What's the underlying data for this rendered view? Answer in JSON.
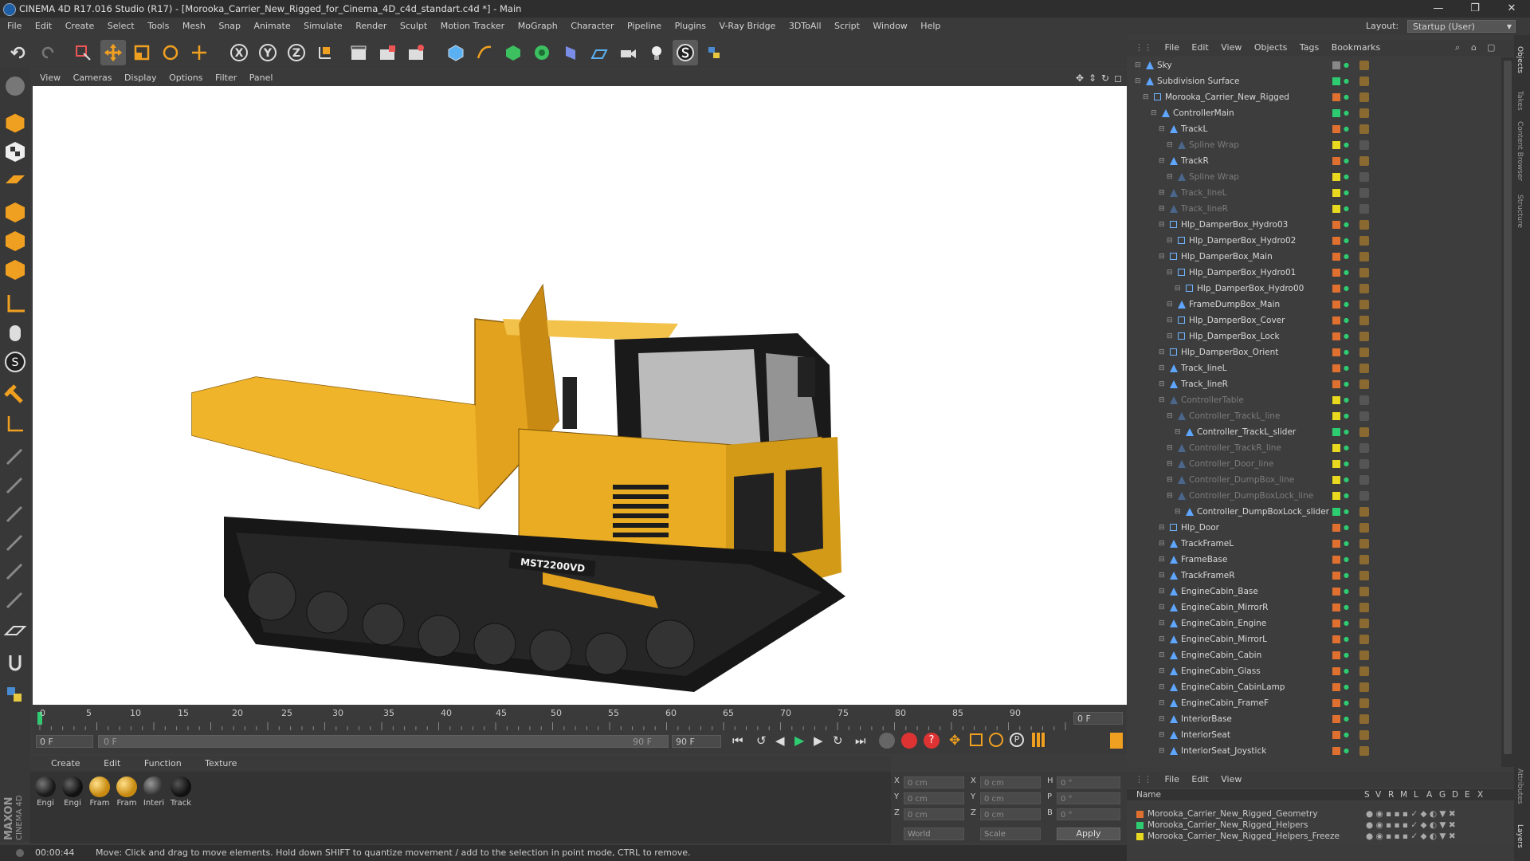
{
  "window": {
    "title": "CINEMA 4D R17.016 Studio (R17) - [Morooka_Carrier_New_Rigged_for_Cinema_4D_c4d_standart.c4d *] - Main",
    "controls": [
      "—",
      "❐",
      "✕"
    ]
  },
  "menu": {
    "items": [
      "File",
      "Edit",
      "Create",
      "Select",
      "Tools",
      "Mesh",
      "Snap",
      "Animate",
      "Simulate",
      "Render",
      "Sculpt",
      "Motion Tracker",
      "MoGraph",
      "Character",
      "Pipeline",
      "Plugins",
      "V-Ray Bridge",
      "3DToAll",
      "Script",
      "Window",
      "Help"
    ],
    "layout_label": "Layout:",
    "layout_value": "Startup (User)"
  },
  "toolbar": {
    "axis_x": "X",
    "axis_y": "Y",
    "axis_z": "Z"
  },
  "viewport": {
    "menu": [
      "View",
      "Cameras",
      "Display",
      "Options",
      "Filter",
      "Panel"
    ],
    "model_label": "MST2200VD"
  },
  "timeline": {
    "ticks": [
      "0",
      "5",
      "10",
      "15",
      "20",
      "25",
      "30",
      "35",
      "40",
      "45",
      "50",
      "55",
      "60",
      "65",
      "70",
      "75",
      "80",
      "85",
      "90"
    ],
    "current_frame_box": "0 F",
    "start_field": "0 F",
    "slider_start": "0 F",
    "slider_end": "90 F",
    "end_field": "90 F"
  },
  "materials": {
    "menu": [
      "Create",
      "Edit",
      "Function",
      "Texture"
    ],
    "items": [
      {
        "label": "Engi",
        "color": "#2a2a2a"
      },
      {
        "label": "Engi",
        "color": "#1c1c1c"
      },
      {
        "label": "Fram",
        "color": "#d9a521"
      },
      {
        "label": "Fram",
        "color": "#d9a521"
      },
      {
        "label": "Interi",
        "color": "#444"
      },
      {
        "label": "Track",
        "color": "#222"
      }
    ]
  },
  "coords": {
    "rows": [
      {
        "a": "X",
        "av": "0 cm",
        "b": "X",
        "bv": "0 cm",
        "c": "H",
        "cv": "0 °"
      },
      {
        "a": "Y",
        "av": "0 cm",
        "b": "Y",
        "bv": "0 cm",
        "c": "P",
        "cv": "0 °"
      },
      {
        "a": "Z",
        "av": "0 cm",
        "b": "Z",
        "bv": "0 cm",
        "c": "B",
        "cv": "0 °"
      }
    ],
    "world": "World",
    "scale": "Scale",
    "apply": "Apply"
  },
  "status": {
    "time": "00:00:44",
    "message": "Move: Click and drag to move elements. Hold down SHIFT to quantize movement / add to the selection in point mode, CTRL to remove."
  },
  "objects": {
    "menu": [
      "File",
      "Edit",
      "View",
      "Objects",
      "Tags",
      "Bookmarks"
    ],
    "rows": [
      {
        "name": "Sky",
        "indent": 0,
        "color": "#888",
        "dim": false
      },
      {
        "name": "Subdivision Surface",
        "indent": 0,
        "color": "#2ecc71",
        "dim": false
      },
      {
        "name": "Morooka_Carrier_New_Rigged",
        "indent": 1,
        "color": "#e07030",
        "dim": false
      },
      {
        "name": "ControllerMain",
        "indent": 2,
        "color": "#2ecc71",
        "dim": false
      },
      {
        "name": "TrackL",
        "indent": 3,
        "color": "#e07030",
        "dim": false
      },
      {
        "name": "Spline Wrap",
        "indent": 4,
        "color": "#e8d820",
        "dim": true
      },
      {
        "name": "TrackR",
        "indent": 3,
        "color": "#e07030",
        "dim": false
      },
      {
        "name": "Spline Wrap",
        "indent": 4,
        "color": "#e8d820",
        "dim": true
      },
      {
        "name": "Track_lineL",
        "indent": 3,
        "color": "#e8d820",
        "dim": true
      },
      {
        "name": "Track_lineR",
        "indent": 3,
        "color": "#e8d820",
        "dim": true
      },
      {
        "name": "Hlp_DamperBox_Hydro03",
        "indent": 3,
        "color": "#e07030",
        "dim": false
      },
      {
        "name": "Hlp_DamperBox_Hydro02",
        "indent": 4,
        "color": "#e07030",
        "dim": false
      },
      {
        "name": "Hlp_DamperBox_Main",
        "indent": 3,
        "color": "#e07030",
        "dim": false
      },
      {
        "name": "Hlp_DamperBox_Hydro01",
        "indent": 4,
        "color": "#e07030",
        "dim": false
      },
      {
        "name": "Hlp_DamperBox_Hydro00",
        "indent": 5,
        "color": "#e07030",
        "dim": false
      },
      {
        "name": "FrameDumpBox_Main",
        "indent": 4,
        "color": "#e07030",
        "dim": false
      },
      {
        "name": "Hlp_DamperBox_Cover",
        "indent": 4,
        "color": "#e07030",
        "dim": false
      },
      {
        "name": "Hlp_DamperBox_Lock",
        "indent": 4,
        "color": "#e07030",
        "dim": false
      },
      {
        "name": "Hlp_DamperBox_Orient",
        "indent": 3,
        "color": "#e07030",
        "dim": false
      },
      {
        "name": "Track_lineL",
        "indent": 3,
        "color": "#e07030",
        "dim": false
      },
      {
        "name": "Track_lineR",
        "indent": 3,
        "color": "#e07030",
        "dim": false
      },
      {
        "name": "ControllerTable",
        "indent": 3,
        "color": "#e8d820",
        "dim": true
      },
      {
        "name": "Controller_TrackL_line",
        "indent": 4,
        "color": "#e8d820",
        "dim": true
      },
      {
        "name": "Controller_TrackL_slider",
        "indent": 5,
        "color": "#2ecc71",
        "dim": false
      },
      {
        "name": "Controller_TrackR_line",
        "indent": 4,
        "color": "#e8d820",
        "dim": true
      },
      {
        "name": "Controller_Door_line",
        "indent": 4,
        "color": "#e8d820",
        "dim": true
      },
      {
        "name": "Controller_DumpBox_line",
        "indent": 4,
        "color": "#e8d820",
        "dim": true
      },
      {
        "name": "Controller_DumpBoxLock_line",
        "indent": 4,
        "color": "#e8d820",
        "dim": true
      },
      {
        "name": "Controller_DumpBoxLock_slider",
        "indent": 5,
        "color": "#2ecc71",
        "dim": false
      },
      {
        "name": "Hlp_Door",
        "indent": 3,
        "color": "#e07030",
        "dim": false
      },
      {
        "name": "TrackFrameL",
        "indent": 3,
        "color": "#e07030",
        "dim": false
      },
      {
        "name": "FrameBase",
        "indent": 3,
        "color": "#e07030",
        "dim": false
      },
      {
        "name": "TrackFrameR",
        "indent": 3,
        "color": "#e07030",
        "dim": false
      },
      {
        "name": "EngineCabin_Base",
        "indent": 3,
        "color": "#e07030",
        "dim": false
      },
      {
        "name": "EngineCabin_MirrorR",
        "indent": 3,
        "color": "#e07030",
        "dim": false
      },
      {
        "name": "EngineCabin_Engine",
        "indent": 3,
        "color": "#e07030",
        "dim": false
      },
      {
        "name": "EngineCabin_MirrorL",
        "indent": 3,
        "color": "#e07030",
        "dim": false
      },
      {
        "name": "EngineCabin_Cabin",
        "indent": 3,
        "color": "#e07030",
        "dim": false
      },
      {
        "name": "EngineCabin_Glass",
        "indent": 3,
        "color": "#e07030",
        "dim": false
      },
      {
        "name": "EngineCabin_CabinLamp",
        "indent": 3,
        "color": "#e07030",
        "dim": false
      },
      {
        "name": "EngineCabin_FrameF",
        "indent": 3,
        "color": "#e07030",
        "dim": false
      },
      {
        "name": "InteriorBase",
        "indent": 3,
        "color": "#e07030",
        "dim": false
      },
      {
        "name": "InteriorSeat",
        "indent": 3,
        "color": "#e07030",
        "dim": false
      },
      {
        "name": "InteriorSeat_Joystick",
        "indent": 3,
        "color": "#e07030",
        "dim": false
      }
    ]
  },
  "layers": {
    "menu": [
      "File",
      "Edit",
      "View"
    ],
    "header_name": "Name",
    "header_flags": [
      "S",
      "V",
      "R",
      "M",
      "L",
      "A",
      "G",
      "D",
      "E",
      "X"
    ],
    "rows": [
      {
        "name": "Morooka_Carrier_New_Rigged_Geometry",
        "color": "#e07030"
      },
      {
        "name": "Morooka_Carrier_New_Rigged_Helpers",
        "color": "#2ecc71"
      },
      {
        "name": "Morooka_Carrier_New_Rigged_Helpers_Freeze",
        "color": "#e8d820"
      }
    ]
  },
  "side_tabs": [
    "Objects",
    "Takes",
    "Content Browser",
    "Structure",
    "Attributes",
    "Layers"
  ],
  "branding": {
    "line1": "MAXON",
    "line2": "CINEMA 4D"
  }
}
